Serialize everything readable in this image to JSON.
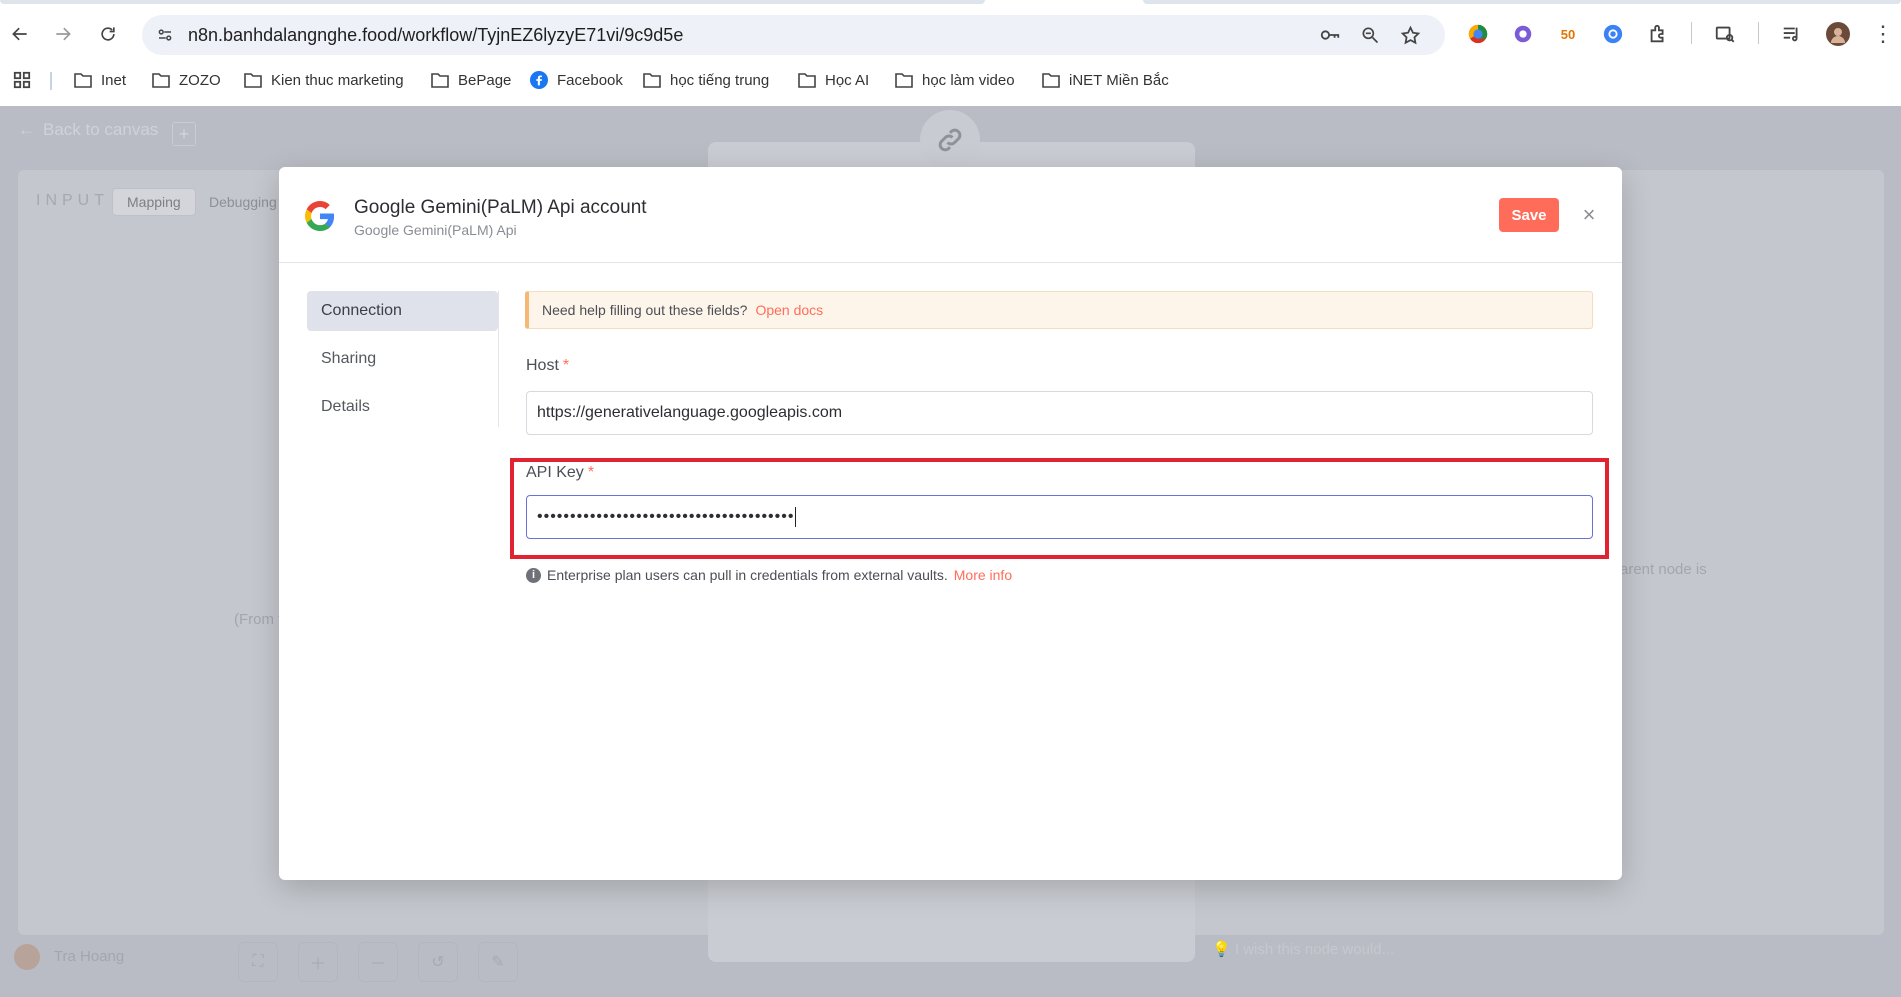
{
  "browser": {
    "url": "n8n.banhdalangnghe.food/workflow/TyjnEZ6lyzyE71vi/9c9d5e",
    "bookmarks": [
      {
        "label": "Inet",
        "icon": "folder-icon"
      },
      {
        "label": "ZOZO",
        "icon": "folder-icon"
      },
      {
        "label": "Kien thuc marketing",
        "icon": "folder-icon"
      },
      {
        "label": "BePage",
        "icon": "folder-icon"
      },
      {
        "label": "Facebook",
        "icon": "facebook-icon"
      },
      {
        "label": "học tiếng trung",
        "icon": "folder-icon"
      },
      {
        "label": "Học AI",
        "icon": "folder-icon"
      },
      {
        "label": "học làm video",
        "icon": "folder-icon"
      },
      {
        "label": "iNET Miền Bắc",
        "icon": "folder-icon"
      }
    ]
  },
  "backdrop": {
    "back_to_canvas": "Back to canvas",
    "input_label": "INPUT",
    "tabs": [
      "Mapping",
      "Debugging"
    ],
    "right_hint": "arent node is",
    "left_hint": "(From t",
    "feedback_hint": "I wish this node would...",
    "user_name": "Tra Hoang"
  },
  "modal": {
    "title": "Google Gemini(PaLM) Api account",
    "subtitle": "Google Gemini(PaLM) Api",
    "save_label": "Save",
    "close_label": "×",
    "nav": [
      "Connection",
      "Sharing",
      "Details"
    ],
    "help_text": "Need help filling out these fields?",
    "help_link": "Open docs",
    "host_label": "Host",
    "host_value": "https://generativelanguage.googleapis.com",
    "api_key_label": "API Key",
    "api_key_value": "•••••••••••••••••••••••••••••••••••••••",
    "required_mark": "*",
    "enterprise_text": "Enterprise plan users can pull in credentials from external vaults.",
    "enterprise_link": "More info",
    "info_glyph": "i"
  },
  "colors": {
    "accent": "#ff6d5a",
    "highlight": "#e02233",
    "focus": "#6872d8"
  }
}
